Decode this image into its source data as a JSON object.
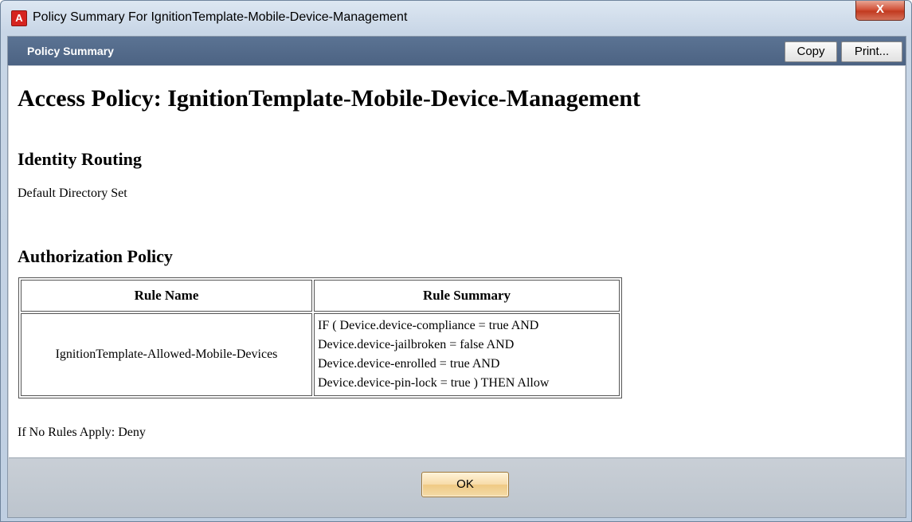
{
  "window": {
    "title": "Policy Summary For IgnitionTemplate-Mobile-Device-Management",
    "app_icon_letter": "A",
    "close_glyph": "X"
  },
  "panel": {
    "title": "Policy Summary",
    "copy_label": "Copy",
    "print_label": "Print..."
  },
  "content": {
    "heading": "Access Policy: IgnitionTemplate-Mobile-Device-Management",
    "identity_heading": "Identity Routing",
    "identity_value": "Default Directory Set",
    "auth_heading": "Authorization Policy",
    "table": {
      "headers": [
        "Rule Name",
        "Rule Summary"
      ],
      "rows": [
        {
          "name": "IgnitionTemplate-Allowed-Mobile-Devices",
          "summary": [
            "IF ( Device.device-compliance = true AND",
            "Device.device-jailbroken = false AND",
            "Device.device-enrolled = true AND",
            "Device.device-pin-lock = true ) THEN Allow"
          ]
        }
      ]
    },
    "no_rules_text": "If No Rules Apply: Deny"
  },
  "footer": {
    "ok_label": "OK"
  },
  "colors": {
    "header_bar": "#4c6383",
    "close_button": "#c23a20",
    "app_icon": "#d6241f"
  }
}
